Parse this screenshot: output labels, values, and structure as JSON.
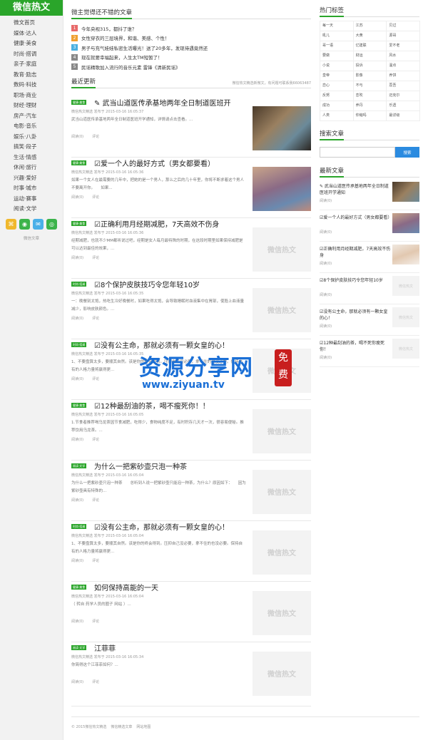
{
  "logo": "微信热文",
  "nav": [
    "微文首页",
    "媒体·达人",
    "健康·美食",
    "时尚·搭调",
    "亲子·家庭",
    "教育·励志",
    "数码·科技",
    "职场·商业",
    "财经·理财",
    "房产·汽车",
    "电影·音乐",
    "娱乐·八卦",
    "搞笑·段子",
    "生活·情感",
    "休闲·旅行",
    "兴趣·爱好",
    "时事·城市",
    "运动·赛事",
    "阅读·文学"
  ],
  "social_note": "微信文章",
  "top_section": {
    "title": "微主觉得还不错的文章",
    "items": [
      {
        "num": "1",
        "color": "#e86a6a",
        "text": "今年央视315，都抖了谁？"
      },
      {
        "num": "2",
        "color": "#f0a030",
        "text": "女性穿衣的三层境界，和谐、美感、个性！"
      },
      {
        "num": "3",
        "color": "#4ab0e0",
        "text": "男子与充气娃娃私密生活曝光！送了20多年，发现待遇竟然还"
      },
      {
        "num": "4",
        "color": "#888888",
        "text": "现在就要幸福起来，人生太TM短暂了！"
      },
      {
        "num": "5",
        "color": "#888888",
        "text": "民谣精歌加入流行的音乐元素 雷锋《清新民谣》"
      }
    ]
  },
  "latest_section": {
    "title": "最近更新",
    "note": "微信热文精选新微文，有问题可联系我66063487"
  },
  "articles": [
    {
      "tag": "健康·美食",
      "title": "✎ 武当山道医传承基地两年全日制道医班开",
      "meta": "微信热文精选 发布于 2015-03-16 16:05:37",
      "excerpt": "武当山道医传承基地两年全日制道医班开学通知，详情请点击查看。...",
      "reads": "阅读(0)",
      "comments": "评论",
      "thumb": "photo1",
      "thumb_text": ""
    },
    {
      "tag": "健康·美食",
      "title": "☑爱一个人的最好方式（男女都要看）",
      "meta": "微信热文精选 发布于 2015-03-16 16:05:36",
      "excerpt": "如果一个女人在最需要的几年中，把她的是一个男人，那么之后的几十年里，你将不断求着这个男人不要离开你。　　如果...",
      "reads": "阅读(0)",
      "comments": "评论",
      "thumb": "photo2",
      "thumb_text": ""
    },
    {
      "tag": "健康·美食",
      "title": "☑正确利用月经期减肥，7天高效不伤身",
      "meta": "微信热文精选 发布于 2015-03-16 16:05:36",
      "excerpt": "经期减肥，也就不少MM都听说过吧，经期是女人每月最特殊的时期，在这段时期里如果保持减肥是可以达到最佳的效果，...",
      "reads": "阅读(0)",
      "comments": "评论",
      "thumb": "",
      "thumb_text": "微信热文"
    },
    {
      "tag": "时尚·搭调",
      "title": "☑8个保护皮肤技巧令您年轻10岁",
      "meta": "微信热文精选 发布于 2015-03-16 16:05:35",
      "excerpt": "一：晚餐别太饱，热吃生冷好晚餐时，如果吃得太饱，会导致睡眠时血液集中在胃部，使脸上血液量减少，影响皮肤颜色。...",
      "reads": "阅读(0)",
      "comments": "评论",
      "thumb": "",
      "thumb_text": "微信热文"
    },
    {
      "tag": "时尚·搭调",
      "title": "☑没有公主命，那就必须有一颗女皇的心！",
      "meta": "微信热文精选 发布于 2015-03-16 16:05:35",
      "excerpt": "1、不要盘算太多，要顺其自然。该是你的终会得到。压抑自己没必要，拿不住的也没必要。保持自有的人格力量将赢得更...",
      "reads": "阅读(0)",
      "comments": "评论",
      "thumb": "",
      "thumb_text": "微信热文"
    },
    {
      "tag": "健康·美食",
      "title": "☑12种最刮油的茶，喝不瘦死你！！",
      "meta": "微信热文精选 发布于 2015-03-16 16:05:05",
      "excerpt": "1.节食者推荐喝乌龙茶因节食减肥，吃得少，食物纯度不足，有时积存几天才一次，很容易便秘。推荐饮用乌龙茶。...",
      "reads": "阅读(0)",
      "comments": "评论",
      "thumb": "",
      "thumb_text": "微信热文"
    },
    {
      "tag": "阅读·文学",
      "title": "为什么一把紫砂壶只泡一种茶",
      "meta": "微信热文精选 发布于 2015-03-16 16:05:04",
      "excerpt": "为什么一把紫砂壶只泡一种茶　　总听到人说一把紫砂壶只能泡一种茶，为什么？原因如下：　　因为紫砂壶具有特殊的...",
      "reads": "阅读(0)",
      "comments": "评论",
      "thumb": "",
      "thumb_text": "微信热文"
    },
    {
      "tag": "时尚·搭调",
      "title": "☑没有公主命，那就必须有一颗女皇的心！",
      "meta": "微信热文精选 发布于 2015-03-16 16:05:04",
      "excerpt": "1、不要盘算太多，要顺其自然。该是你的终会得到。压抑自己没必要，拿不住的也没必要。保持自有的人格力量将赢得更...",
      "reads": "阅读(0)",
      "comments": "评论",
      "thumb": "",
      "thumb_text": "微信热文"
    },
    {
      "tag": "健康·美食",
      "title": "如何保持高能的一天",
      "meta": "微信热文精选 发布于 2015-03-16 16:05:04",
      "excerpt": "（ 转自 药学人员的圈子 网站 ）...",
      "reads": "阅读(0)",
      "comments": "评论",
      "thumb": "",
      "thumb_text": "微信热文"
    },
    {
      "tag": "阅读·文学",
      "title": "江菲菲",
      "meta": "微信热文精选 发布于 2015-03-16 16:05:34",
      "excerpt": "你简得这个江菲菲如何？...",
      "reads": "阅读(0)",
      "comments": "评论",
      "thumb": "",
      "thumb_text": "微信热文"
    }
  ],
  "right": {
    "tags_title": "热门标签",
    "tags": [
      "每一天",
      "江苏",
      "贝过",
      "吼儿",
      "大黄",
      "源哥",
      "哥一语",
      "亿建联",
      "爱不老",
      "要做",
      "财运",
      "风水",
      "小说",
      "投诉",
      "温点",
      "皇帝",
      "影像",
      "养饼",
      "恋心",
      "不与",
      "荔吾",
      "反努",
      "恋吹",
      "迈克尔",
      "成功",
      "养丹",
      "乐透",
      "人类",
      "你缩吗",
      "最详级"
    ],
    "search_title": "搜索文章",
    "search_placeholder": "",
    "search_button": "搜索",
    "latest_title": "最新文章",
    "latest": [
      {
        "title": "✎ 武当山道医传承基地两年全日制道医班开学通知",
        "meta": "阅读(0)",
        "thumb": "p1",
        "thumb_text": ""
      },
      {
        "title": "☑爱一个人的最好方式（男女都要看）",
        "meta": "阅读(0)",
        "thumb": "p2",
        "thumb_text": ""
      },
      {
        "title": "☑正确利用月经期减肥，7天高效不伤身",
        "meta": "阅读(0)",
        "thumb": "p3",
        "thumb_text": ""
      },
      {
        "title": "☑8个保护皮肤技巧令您年轻10岁",
        "meta": "阅读(0)",
        "thumb": "",
        "thumb_text": "微信热文"
      },
      {
        "title": "☑没有公主命，那就必须有一颗女皇的心！",
        "meta": "阅读(0)",
        "thumb": "",
        "thumb_text": "微信热文"
      },
      {
        "title": "☑12种最刮油的茶，喝不死你瘦死你！",
        "meta": "阅读(0)",
        "thumb": "",
        "thumb_text": "微信热文"
      }
    ]
  },
  "watermark": {
    "main": "资源分享网",
    "url": "www.ziyuan.tv",
    "seal": "免费"
  },
  "footer": [
    "© 2015微信热文精选",
    "微信精选文章",
    "网站地图"
  ],
  "colors": {
    "accent": "#2aa52a",
    "button": "#2b8be0"
  }
}
